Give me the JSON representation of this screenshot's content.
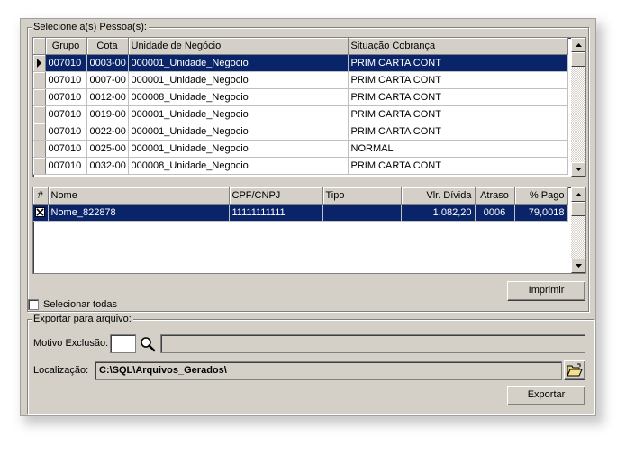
{
  "pessoas": {
    "legend": "Selecione a(s) Pessoa(s):",
    "columns": [
      "Grupo",
      "Cota",
      "Unidade de Negócio",
      "Situação Cobrança"
    ],
    "rows": [
      {
        "grupo": "007010",
        "cota": "0003-00",
        "unidade": "000001_Unidade_Negocio",
        "situacao": "PRIM CARTA CONT"
      },
      {
        "grupo": "007010",
        "cota": "0007-00",
        "unidade": "000001_Unidade_Negocio",
        "situacao": "PRIM CARTA CONT"
      },
      {
        "grupo": "007010",
        "cota": "0012-00",
        "unidade": "000008_Unidade_Negocio",
        "situacao": "PRIM CARTA CONT"
      },
      {
        "grupo": "007010",
        "cota": "0019-00",
        "unidade": "000001_Unidade_Negocio",
        "situacao": "PRIM CARTA CONT"
      },
      {
        "grupo": "007010",
        "cota": "0022-00",
        "unidade": "000001_Unidade_Negocio",
        "situacao": "PRIM CARTA CONT"
      },
      {
        "grupo": "007010",
        "cota": "0025-00",
        "unidade": "000001_Unidade_Negocio",
        "situacao": "NORMAL"
      },
      {
        "grupo": "007010",
        "cota": "0032-00",
        "unidade": "000008_Unidade_Negocio",
        "situacao": "PRIM CARTA CONT"
      }
    ]
  },
  "detalhe": {
    "columns": [
      "#",
      "Nome",
      "CPF/CNPJ",
      "Tipo",
      "Vlr. Dívida",
      "Atraso",
      "% Pago"
    ],
    "rows": [
      {
        "nome": "Nome_822878",
        "cpf": "11111111111",
        "tipo": "",
        "valor": "1.082,20",
        "atraso": "0006",
        "pago": "79,0018"
      }
    ]
  },
  "imprimir_label": "Imprimir",
  "selecionar_todas_label": "Selecionar todas",
  "exportar": {
    "legend": "Exportar para arquivo:",
    "motivo_label": "Motivo Exclusão:",
    "motivo_value": "",
    "motivo_desc": "",
    "localizacao_label": "Localização:",
    "localizacao_value": "C:\\SQL\\Arquivos_Gerados\\",
    "exportar_label": "Exportar"
  },
  "colors": {
    "selection": "#0a246a",
    "face": "#d4d0c8"
  },
  "icons": {
    "search": "magnifier-icon",
    "folder": "open-folder-icon",
    "current_row": "row-pointer-icon",
    "checked": "x-checkbox-icon"
  }
}
